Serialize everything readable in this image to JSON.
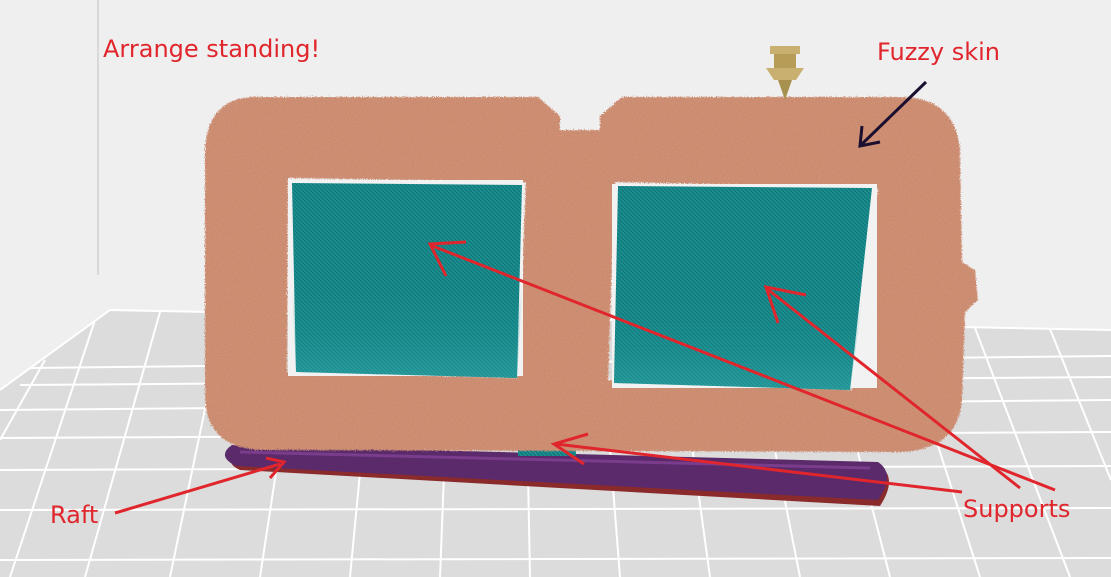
{
  "annotations": {
    "arrange": "Arrange standing!",
    "fuzzy_skin": "Fuzzy skin",
    "raft": "Raft",
    "supports": "Supports"
  },
  "colors": {
    "background": "#efeff0",
    "bed_plate": "#dcdcdc",
    "grid_line": "#ffffff",
    "model_fuzzy_skin": "#d9967a",
    "support_fill": "#1a8e8f",
    "raft": "#5a2a6b",
    "raft_edge": "#8a2a2a",
    "nozzle": "#c9b070",
    "annotation_text": "#e0262c",
    "fuzzy_arrow": "#1a0f2e"
  },
  "icons": {
    "nozzle": "nozzle-icon"
  }
}
